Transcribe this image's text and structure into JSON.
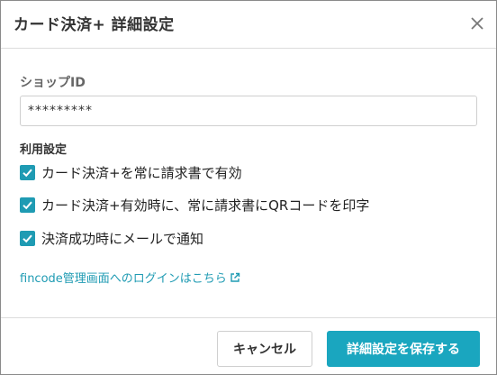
{
  "dialog": {
    "title": "カード決済+ 詳細設定",
    "close_icon": "close-icon"
  },
  "shop_id": {
    "label": "ショップID",
    "value": "*********"
  },
  "usage": {
    "label": "利用設定",
    "options": [
      {
        "label": "カード決済+を常に請求書で有効",
        "checked": true
      },
      {
        "label": "カード決済+有効時に、常に請求書にQRコードを印字",
        "checked": true
      },
      {
        "label": "決済成功時にメールで通知",
        "checked": true
      }
    ]
  },
  "link": {
    "text": "fincode管理画面へのログインはこちら",
    "icon": "external-link-icon"
  },
  "footer": {
    "cancel_label": "キャンセル",
    "save_label": "詳細設定を保存する"
  },
  "colors": {
    "accent": "#1aa6bf",
    "checkbox": "#1f9bb3",
    "link": "#1f9bb3"
  }
}
